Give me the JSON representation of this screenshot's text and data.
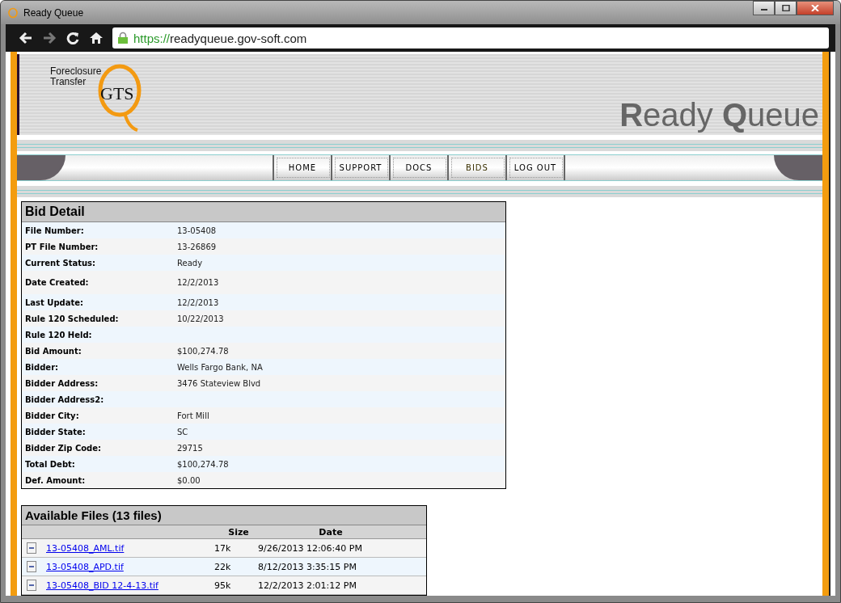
{
  "window": {
    "title": "Ready Queue"
  },
  "browser": {
    "url_scheme": "https://",
    "url_rest": "readyqueue.gov-soft.com"
  },
  "header": {
    "logo_line1": "Foreclosure",
    "logo_line2": "Transfer",
    "logo_mark": "GTS",
    "site_title": "**R**eady **Q**ueue"
  },
  "nav": [
    {
      "label": "HOME",
      "selected": false
    },
    {
      "label": "SUPPORT",
      "selected": false
    },
    {
      "label": "DOCS",
      "selected": false
    },
    {
      "label": "BIDS",
      "selected": true
    },
    {
      "label": "LOG OUT",
      "selected": false
    }
  ],
  "bid_detail": {
    "title": "Bid Detail",
    "rows": [
      {
        "label": "File Number:",
        "value": "13-05408"
      },
      {
        "label": "PT File Number:",
        "value": "13-26869"
      },
      {
        "label": "Current Status:",
        "value": "Ready"
      },
      {
        "label": "Date Created:",
        "value": "12/2/2013",
        "tall": true
      },
      {
        "label": "Last Update:",
        "value": "12/2/2013"
      },
      {
        "label": "Rule 120 Scheduled:",
        "value": "10/22/2013"
      },
      {
        "label": "Rule 120 Held:"
      },
      {
        "label": "Bid Amount:",
        "value": "$100,274.78"
      },
      {
        "label": "Bidder:",
        "value": "Wells Fargo Bank, NA"
      },
      {
        "label": "Bidder Address:",
        "value": "3476 Stateview Blvd"
      },
      {
        "label": "Bidder Address2:"
      },
      {
        "label": "Bidder City:",
        "value": "Fort Mill"
      },
      {
        "label": "Bidder State:",
        "value": "SC"
      },
      {
        "label": "Bidder Zip Code:",
        "value": "29715"
      },
      {
        "label": "Total Debt:",
        "value": "$100,274.78"
      },
      {
        "label": "Def. Amount:",
        "value": "$0.00"
      }
    ]
  },
  "files": {
    "title": "Available Files (13 files)",
    "columns": [
      "Size",
      "Date"
    ],
    "rows": [
      {
        "name": "13-05408_AML.tif",
        "size": "17k",
        "date": "9/26/2013 12:06:40 PM"
      },
      {
        "name": "13-05408_APD.tif",
        "size": "22k",
        "date": "8/12/2013 3:35:15 PM"
      },
      {
        "name": "13-05408_BID 12-4-13.tif",
        "size": "95k",
        "date": "12/2/2013 2:01:12 PM"
      }
    ]
  }
}
